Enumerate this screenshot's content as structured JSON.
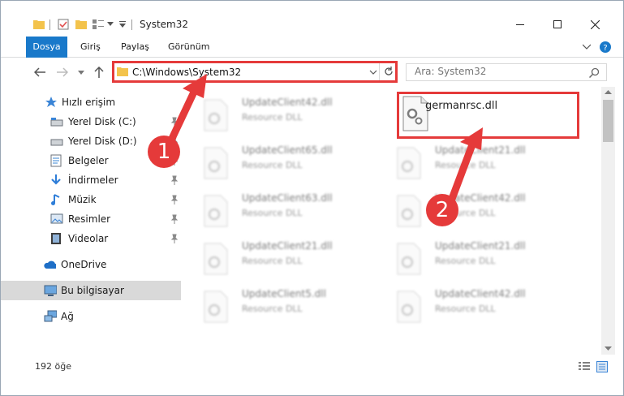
{
  "window": {
    "title": "System32",
    "minimize": "minimize",
    "maximize": "maximize",
    "close": "close"
  },
  "ribbon": {
    "tabs": [
      "Dosya",
      "Giriş",
      "Paylaş",
      "Görünüm"
    ]
  },
  "address": {
    "path": "C:\\Windows\\System32"
  },
  "search": {
    "placeholder": "Ara: System32"
  },
  "sidebar": {
    "items": [
      {
        "label": "Hızlı erişim"
      },
      {
        "label": "Yerel Disk (C:)"
      },
      {
        "label": "Yerel Disk (D:)"
      },
      {
        "label": "Belgeler"
      },
      {
        "label": "İndirmeler"
      },
      {
        "label": "Müzik"
      },
      {
        "label": "Resimler"
      },
      {
        "label": "Videolar"
      },
      {
        "label": "OneDrive"
      },
      {
        "label": "Bu bilgisayar"
      },
      {
        "label": "Ağ"
      }
    ]
  },
  "files": {
    "left": [
      {
        "name": "UpdateClient42.dll",
        "type": "Resource DLL"
      },
      {
        "name": "UpdateClient65.dll",
        "type": "Resource DLL"
      },
      {
        "name": "UpdateClient63.dll",
        "type": "Resource DLL"
      },
      {
        "name": "UpdateClient21.dll",
        "type": "Resource DLL"
      },
      {
        "name": "UpdateClient5.dll",
        "type": "Resource DLL"
      }
    ],
    "right": [
      {
        "name": "UpdateClient21.dll",
        "type": "Resource DLL"
      },
      {
        "name": "UpdateClient42.dll",
        "type": "Resource DLL"
      },
      {
        "name": "UpdateClient21.dll",
        "type": "Resource DLL"
      },
      {
        "name": "UpdateClient42.dll",
        "type": "Resource DLL"
      }
    ],
    "highlighted": {
      "name": "germanrsc.dll"
    }
  },
  "status": {
    "count": "192 öğe"
  },
  "annotations": {
    "step1": "1",
    "step2": "2"
  },
  "colors": {
    "accent": "#1979ca",
    "highlight": "#e53a3a",
    "selected": "#d9d9d9"
  }
}
